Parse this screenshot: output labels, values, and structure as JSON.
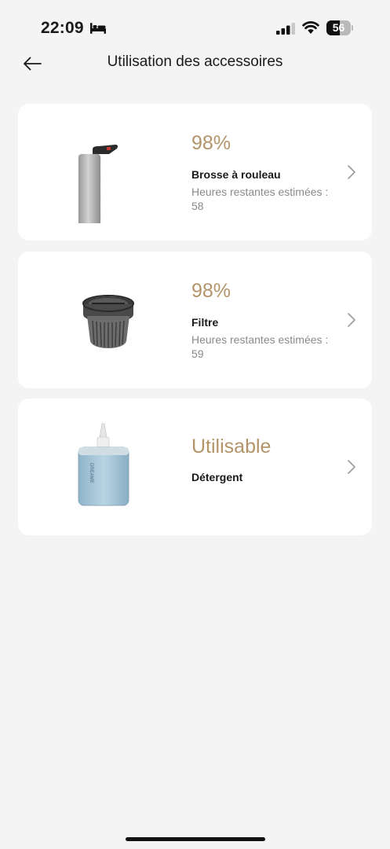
{
  "status_bar": {
    "time": "22:09",
    "battery": "56",
    "battery_level": 0.56
  },
  "header": {
    "title": "Utilisation des accessoires"
  },
  "accessories": [
    {
      "status": "98%",
      "name": "Brosse à rouleau",
      "remaining_label": "Heures restantes estimées :",
      "remaining_value": "58",
      "image_icon": "roller-brush-image"
    },
    {
      "status": "98%",
      "name": "Filtre",
      "remaining_label": "Heures restantes estimées :",
      "remaining_value": "59",
      "image_icon": "filter-image"
    },
    {
      "status": "Utilisable",
      "name": "Détergent",
      "image_icon": "detergent-bottle-image"
    }
  ],
  "colors": {
    "accent": "#b39469",
    "background": "#f4f4f4",
    "card": "#ffffff",
    "secondary_text": "#8a8a8a"
  }
}
